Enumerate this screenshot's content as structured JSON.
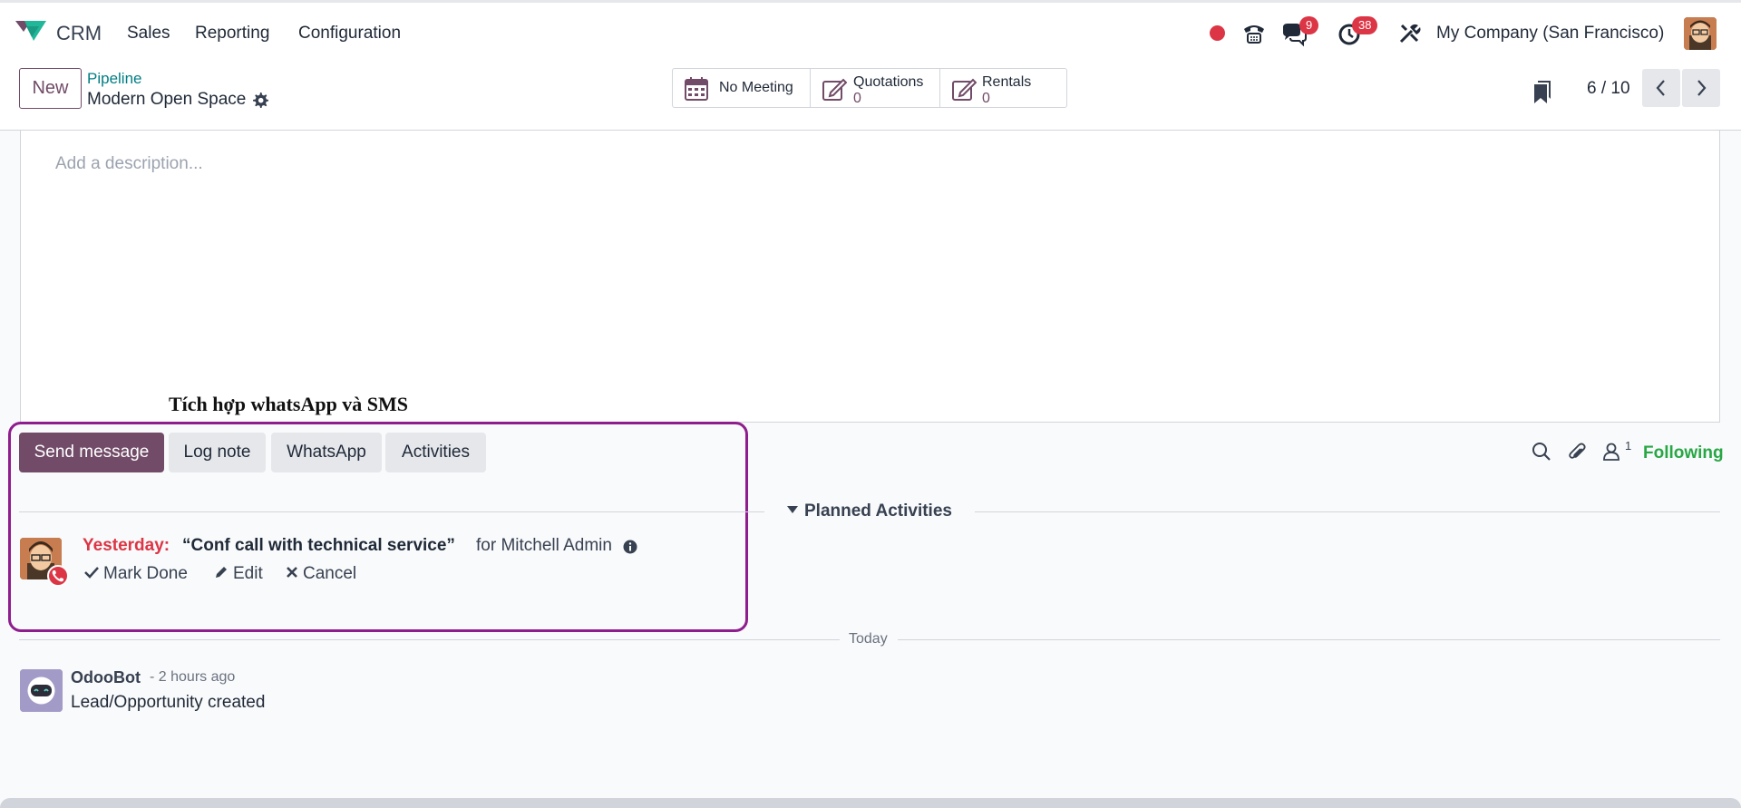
{
  "topnav": {
    "app_name": "CRM",
    "menu": [
      "Sales",
      "Reporting",
      "Configuration"
    ],
    "messages_badge": "9",
    "activities_badge": "38",
    "company": "My Company (San Francisco)"
  },
  "control_panel": {
    "new_label": "New",
    "breadcrumb_parent": "Pipeline",
    "record_name": "Modern Open Space",
    "smart_buttons": {
      "meeting_label": "No Meeting",
      "quotations_label": "Quotations",
      "quotations_value": "0",
      "rentals_label": "Rentals",
      "rentals_value": "0"
    },
    "pager": "6 / 10"
  },
  "form": {
    "description_placeholder": "Add a description..."
  },
  "annotation": {
    "title": "Tích hợp whatsApp và SMS",
    "color": "#8e1d8e"
  },
  "chatter": {
    "buttons": {
      "send_message": "Send message",
      "log_note": "Log note",
      "whatsapp": "WhatsApp",
      "activities": "Activities"
    },
    "followers_count": "1",
    "following_label": "Following",
    "planned_label": "Planned Activities",
    "activity": {
      "when": "Yesterday:",
      "title": "“Conf call with technical service”",
      "for": "for Mitchell Admin",
      "mark_done": "Mark Done",
      "edit": "Edit",
      "cancel": "Cancel"
    },
    "today_label": "Today",
    "message": {
      "author": "OdooBot",
      "time": "- 2 hours ago",
      "body": "Lead/Opportunity created"
    }
  },
  "colors": {
    "brand": "#714b67",
    "danger": "#dc3545",
    "link": "#017e84",
    "success": "#28a745"
  }
}
